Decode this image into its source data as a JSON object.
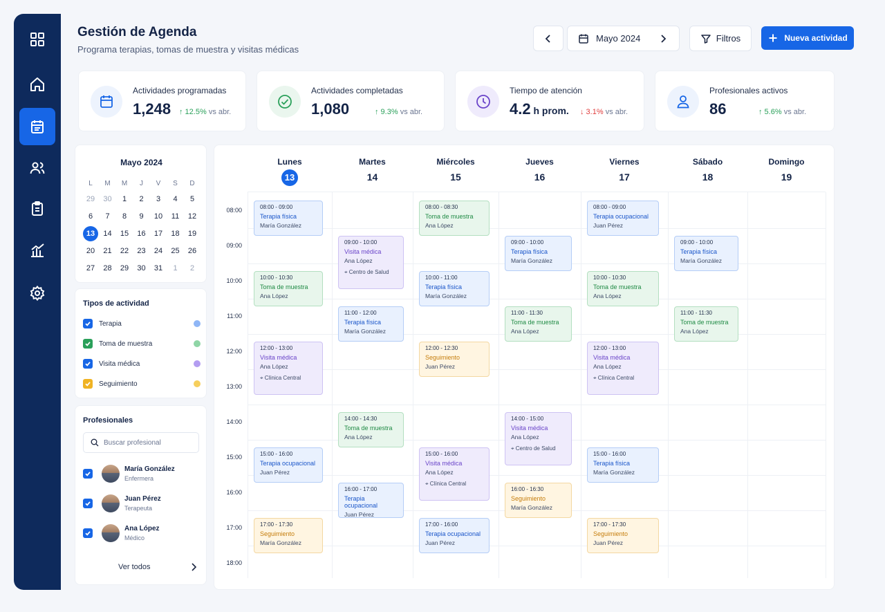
{
  "header": {
    "title": "Gestión de Agenda",
    "subtitle": "Programa terapias, tomas de muestra y visitas médicas",
    "month": "Mayo 2024",
    "filters_label": "Filtros",
    "new_label": "Nueva actividad"
  },
  "sidebar": {
    "items": [
      {
        "icon": "grid-icon"
      },
      {
        "icon": "home-icon"
      },
      {
        "icon": "calendar-icon",
        "active": true
      },
      {
        "icon": "users-icon"
      },
      {
        "icon": "clipboard-icon"
      },
      {
        "icon": "chart-icon"
      },
      {
        "icon": "gear-icon"
      }
    ]
  },
  "stats": [
    {
      "label": "Actividades programadas",
      "value": "1,248",
      "unit": "",
      "change": "↑ 12.5%",
      "vs": "vs abr.",
      "trend": "up",
      "icon": "calendar-icon",
      "color": "#1766e6"
    },
    {
      "label": "Actividades completadas",
      "value": "1,080",
      "unit": "",
      "change": "↑ 9.3%",
      "vs": "vs abr.",
      "trend": "up",
      "icon": "check-circle-icon",
      "color": "#2aa05a"
    },
    {
      "label": "Tiempo de atención",
      "value": "4.2",
      "unit": " h prom.",
      "change": "↓ 3.1%",
      "vs": "vs abr.",
      "trend": "down",
      "icon": "clock-icon",
      "color": "#6a44c9"
    },
    {
      "label": "Profesionales activos",
      "value": "86",
      "unit": "",
      "change": "↑ 5.6%",
      "vs": "vs abr.",
      "trend": "up",
      "icon": "user-icon",
      "color": "#1766e6"
    }
  ],
  "mini_calendar": {
    "title": "Mayo 2024",
    "weekdays": [
      "L",
      "M",
      "M",
      "J",
      "V",
      "S",
      "D"
    ],
    "weeks": [
      [
        "29",
        "30",
        "1",
        "2",
        "3",
        "4",
        "5"
      ],
      [
        "6",
        "7",
        "8",
        "9",
        "10",
        "11",
        "12"
      ],
      [
        "13",
        "14",
        "15",
        "16",
        "17",
        "18",
        "19"
      ],
      [
        "20",
        "21",
        "22",
        "23",
        "24",
        "25",
        "26"
      ],
      [
        "27",
        "28",
        "29",
        "30",
        "31",
        "1",
        "2"
      ]
    ],
    "selected": "13"
  },
  "activity_types": {
    "title": "Tipos de actividad",
    "items": [
      {
        "label": "Terapia",
        "check_color": "#1766e6",
        "dot_color": "#8fb6f6"
      },
      {
        "label": "Toma de muestra",
        "check_color": "#2aa05a",
        "dot_color": "#8fd5a6"
      },
      {
        "label": "Visita médica",
        "check_color": "#1766e6",
        "dot_color": "#b39df1"
      },
      {
        "label": "Seguimiento",
        "check_color": "#f0b323",
        "dot_color": "#f6cf5d"
      }
    ]
  },
  "professionals": {
    "title": "Profesionales",
    "search_placeholder": "Buscar profesional",
    "items": [
      {
        "name": "María González",
        "role": "Enfermera"
      },
      {
        "name": "Juan Pérez",
        "role": "Terapeuta"
      },
      {
        "name": "Ana López",
        "role": "Médico"
      }
    ],
    "see_all": "Ver todos"
  },
  "calendar": {
    "days": [
      {
        "name": "Lunes",
        "num": "13",
        "today": true
      },
      {
        "name": "Martes",
        "num": "14"
      },
      {
        "name": "Miércoles",
        "num": "15"
      },
      {
        "name": "Jueves",
        "num": "16"
      },
      {
        "name": "Viernes",
        "num": "17"
      },
      {
        "name": "Sábado",
        "num": "18"
      },
      {
        "name": "Domingo",
        "num": "19"
      }
    ],
    "hours": [
      "08:00",
      "09:00",
      "10:00",
      "11:00",
      "12:00",
      "13:00",
      "14:00",
      "15:00",
      "16:00",
      "17:00",
      "18:00"
    ],
    "events": [
      {
        "day": 0,
        "start": 8,
        "end": 9,
        "type": "terapia",
        "time": "08:00 - 09:00",
        "title": "Terapia física",
        "person": "María González"
      },
      {
        "day": 0,
        "start": 10,
        "end": 11,
        "type": "toma",
        "time": "10:00 - 10:30",
        "title": "Toma de muestra",
        "person": "Ana López"
      },
      {
        "day": 0,
        "start": 12,
        "end": 13.5,
        "type": "visita",
        "time": "12:00 - 13:00",
        "title": "Visita médica",
        "person": "Ana López",
        "location": "Clínica Central"
      },
      {
        "day": 0,
        "start": 15,
        "end": 16,
        "type": "terapia",
        "time": "15:00 - 16:00",
        "title": "Terapia ocupacional",
        "person": "Juan Pérez"
      },
      {
        "day": 0,
        "start": 17,
        "end": 18,
        "type": "seguimiento",
        "time": "17:00 - 17:30",
        "title": "Seguimiento",
        "person": "María González"
      },
      {
        "day": 1,
        "start": 9,
        "end": 10.5,
        "type": "visita",
        "time": "09:00 - 10:00",
        "title": "Visita médica",
        "person": "Ana López",
        "location": "Centro de Salud"
      },
      {
        "day": 1,
        "start": 11,
        "end": 12,
        "type": "terapia",
        "time": "11:00 - 12:00",
        "title": "Terapia física",
        "person": "María González"
      },
      {
        "day": 1,
        "start": 14,
        "end": 15,
        "type": "toma",
        "time": "14:00 - 14:30",
        "title": "Toma de muestra",
        "person": "Ana López"
      },
      {
        "day": 1,
        "start": 16,
        "end": 17,
        "type": "terapia",
        "time": "16:00 - 17:00",
        "title": "Terapia ocupacional",
        "person": "Juan Pérez"
      },
      {
        "day": 2,
        "start": 8,
        "end": 9,
        "type": "toma",
        "time": "08:00 - 08:30",
        "title": "Toma de muestra",
        "person": "Ana López"
      },
      {
        "day": 2,
        "start": 10,
        "end": 11,
        "type": "terapia",
        "time": "10:00 - 11:00",
        "title": "Terapia física",
        "person": "María González"
      },
      {
        "day": 2,
        "start": 12,
        "end": 13,
        "type": "seguimiento",
        "time": "12:00 - 12:30",
        "title": "Seguimiento",
        "person": "Juan Pérez"
      },
      {
        "day": 2,
        "start": 15,
        "end": 16.5,
        "type": "visita",
        "time": "15:00 - 16:00",
        "title": "Visita médica",
        "person": "Ana López",
        "location": "Clínica Central"
      },
      {
        "day": 2,
        "start": 17,
        "end": 18,
        "type": "terapia",
        "time": "17:00 - 16:00",
        "title": "Terapia ocupacional",
        "person": "Juan Pérez"
      },
      {
        "day": 3,
        "start": 9,
        "end": 10,
        "type": "terapia",
        "time": "09:00 - 10:00",
        "title": "Terapia física",
        "person": "María González"
      },
      {
        "day": 3,
        "start": 11,
        "end": 12,
        "type": "toma",
        "time": "11:00 - 11:30",
        "title": "Toma de muestra",
        "person": "Ana López"
      },
      {
        "day": 3,
        "start": 14,
        "end": 15.5,
        "type": "visita",
        "time": "14:00 - 15:00",
        "title": "Visita médica",
        "person": "Ana López",
        "location": "Centro de Salud"
      },
      {
        "day": 3,
        "start": 16,
        "end": 17,
        "type": "seguimiento",
        "time": "16:00 - 16:30",
        "title": "Seguimiento",
        "person": "María González"
      },
      {
        "day": 4,
        "start": 8,
        "end": 9,
        "type": "terapia",
        "time": "08:00 - 09:00",
        "title": "Terapia ocupacional",
        "person": "Juan Pérez"
      },
      {
        "day": 4,
        "start": 10,
        "end": 11,
        "type": "toma",
        "time": "10:00 - 10:30",
        "title": "Toma de muestra",
        "person": "Ana López"
      },
      {
        "day": 4,
        "start": 12,
        "end": 13.5,
        "type": "visita",
        "time": "12:00 - 13:00",
        "title": "Visita médica",
        "person": "Ana López",
        "location": "Clínica Central"
      },
      {
        "day": 4,
        "start": 15,
        "end": 16,
        "type": "terapia",
        "time": "15:00 - 16:00",
        "title": "Terapia física",
        "person": "María González"
      },
      {
        "day": 4,
        "start": 17,
        "end": 18,
        "type": "seguimiento",
        "time": "17:00 - 17:30",
        "title": "Seguimiento",
        "person": "Juan Pérez"
      },
      {
        "day": 5,
        "start": 9,
        "end": 10,
        "type": "terapia",
        "time": "09:00 - 10:00",
        "title": "Terapia física",
        "person": "María González"
      },
      {
        "day": 5,
        "start": 11,
        "end": 12,
        "type": "toma",
        "time": "11:00 - 11:30",
        "title": "Toma de muestra",
        "person": "Ana López"
      }
    ]
  }
}
